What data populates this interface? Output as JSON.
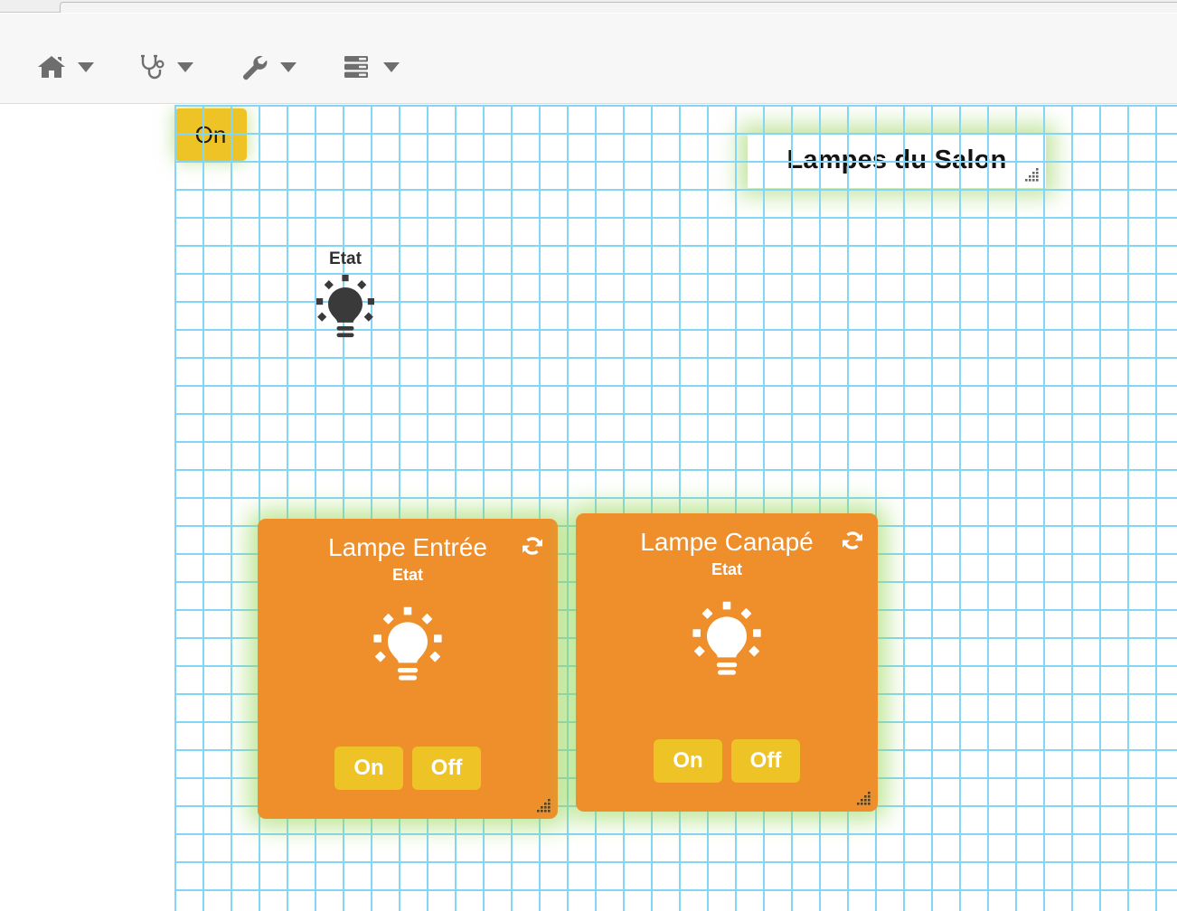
{
  "window": {
    "chrome_visible": true
  },
  "toolbar": {
    "items": [
      {
        "icon": "home-icon",
        "label": "Home",
        "has_caret": true
      },
      {
        "icon": "stethoscope-icon",
        "label": "Diagnostic",
        "has_caret": true
      },
      {
        "icon": "wrench-icon",
        "label": "Tools",
        "has_caret": true
      },
      {
        "icon": "server-icon",
        "label": "Server",
        "has_caret": true
      }
    ]
  },
  "canvas": {
    "grid": {
      "visible": true,
      "cell_size_px": 31,
      "line_color": "#84d6f7"
    },
    "background": "#ffffff"
  },
  "widgets": {
    "standalone_button": {
      "label": "On",
      "color": "#eec326",
      "text_color": "#201c14"
    },
    "title_panel": {
      "text": "Lampes du Salon",
      "background": "#ffffff",
      "glow_color": "#96d25a"
    },
    "free_state": {
      "label": "Etat",
      "icon": "lightbulb-icon",
      "icon_color": "#3a3a3a"
    },
    "cards": [
      {
        "title": "Lampe Entrée",
        "refresh_icon": "refresh-icon",
        "state_label": "Etat",
        "state_icon": "lightbulb-icon",
        "buttons": [
          {
            "label": "On"
          },
          {
            "label": "Off"
          }
        ],
        "background": "#ee8f2c",
        "button_color": "#eec326",
        "glow_color": "#96d755",
        "resize_handle": "resize-grip-icon"
      },
      {
        "title": "Lampe Canapé",
        "refresh_icon": "refresh-icon",
        "state_label": "Etat",
        "state_icon": "lightbulb-icon",
        "buttons": [
          {
            "label": "On"
          },
          {
            "label": "Off"
          }
        ],
        "background": "#ee8f2c",
        "button_color": "#eec326",
        "glow_color": "#96d755",
        "resize_handle": "resize-grip-icon"
      }
    ]
  }
}
